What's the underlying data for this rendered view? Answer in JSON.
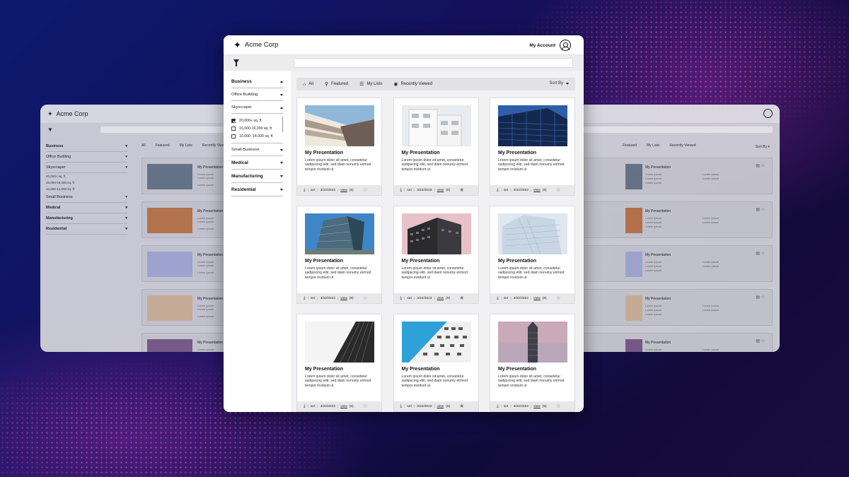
{
  "app": {
    "name": "Acme Corp",
    "account_label": "My Account",
    "search_placeholder": ""
  },
  "sidebar": {
    "sections": [
      {
        "label": "Business",
        "bold": true,
        "expanded": true
      },
      {
        "label": "Office Building",
        "bold": false,
        "expanded": false
      },
      {
        "label": "Skyscraper",
        "bold": false,
        "expanded": true
      },
      {
        "label": "Small Business",
        "bold": false,
        "expanded": false
      },
      {
        "label": "Medical",
        "bold": true,
        "expanded": false
      },
      {
        "label": "Manufacturing",
        "bold": true,
        "expanded": false
      },
      {
        "label": "Residential",
        "bold": true,
        "expanded": false
      }
    ],
    "skyscraper_options": [
      {
        "label": "20,000+ sq. ft",
        "checked": true
      },
      {
        "label": "15,000-19,000 sq. ft",
        "checked": false
      },
      {
        "label": "10,000- 14,000 sq. ft",
        "checked": false
      }
    ]
  },
  "tabs": [
    {
      "label": "All",
      "icon": "home-icon"
    },
    {
      "label": "Featured",
      "icon": "pin-icon"
    },
    {
      "label": "My Lists",
      "icon": "list-icon"
    },
    {
      "label": "Recently Viewed",
      "icon": "eye-icon"
    }
  ],
  "sort_label": "Sort By",
  "cards": [
    {
      "title": "My Presentation",
      "desc": "Lorem ipsum dolor sit amet, consetetur sadipscing elitr, sed diam nonumy eirmod tempor invidunt ut",
      "set": "set",
      "date": "3/22/2023",
      "view": "view",
      "count": "(8)",
      "starred": false,
      "img": "building-1"
    },
    {
      "title": "My Presentation",
      "desc": "Lorem ipsum dolor sit amet, consetetur sadipscing elitr, sed diam nonumy eirmod tempor invidunt ut",
      "set": "set",
      "date": "3/22/2023",
      "view": "view",
      "count": "(8)",
      "starred": true,
      "img": "building-2"
    },
    {
      "title": "My Presentation",
      "desc": "Lorem ipsum dolor sit amet, consetetur sadipscing elitr, sed diam nonumy eirmod tempor invidunt ut",
      "set": "set",
      "date": "3/22/2023",
      "view": "view",
      "count": "(8)",
      "starred": false,
      "img": "building-3"
    },
    {
      "title": "My Presentation",
      "desc": "Lorem ipsum dolor sit amet, consetetur sadipscing elitr, sed diam nonumy eirmod tempor invidunt ut",
      "set": "set",
      "date": "3/22/2023",
      "view": "view",
      "count": "(8)",
      "starred": false,
      "img": "building-4"
    },
    {
      "title": "My Presentation",
      "desc": "Lorem ipsum dolor sit amet, consetetur sadipscing elitr, sed diam nonumy eirmod tempor invidunt ut",
      "set": "set",
      "date": "3/22/2023",
      "view": "view",
      "count": "(8)",
      "starred": true,
      "img": "building-5"
    },
    {
      "title": "My Presentation",
      "desc": "Lorem ipsum dolor sit amet, consetetur sadipscing elitr, sed diam nonumy eirmod tempor invidunt ut",
      "set": "set",
      "date": "3/22/2023",
      "view": "view",
      "count": "(8)",
      "starred": false,
      "img": "building-6"
    },
    {
      "title": "My Presentation",
      "desc": "Lorem ipsum dolor sit amet, consetetur sadipscing elitr, sed diam nonumy eirmod tempor invidunt ut",
      "set": "set",
      "date": "3/22/2023",
      "view": "view",
      "count": "(8)",
      "starred": false,
      "img": "building-7"
    },
    {
      "title": "My Presentation",
      "desc": "Lorem ipsum dolor sit amet, consetetur sadipscing elitr, sed diam nonumy eirmod tempor invidunt ut",
      "set": "set",
      "date": "3/22/2023",
      "view": "view",
      "count": "(8)",
      "starred": true,
      "img": "building-8"
    },
    {
      "title": "My Presentation",
      "desc": "Lorem ipsum dolor sit amet, consetetur sadipscing elitr, sed diam nonumy eirmod tempor invidunt ut",
      "set": "set",
      "date": "3/22/2023",
      "view": "view",
      "count": "(8)",
      "starred": false,
      "img": "building-9"
    }
  ],
  "back_window": {
    "name": "Acme Corp",
    "sidebar": [
      "Business",
      "Office Building",
      "Skyscraper",
      "20,000+ sq. ft",
      "15,000-19,000 sq. ft",
      "10,000-14,000 sq. ft",
      "Small Business",
      "Medical",
      "Manufacturing",
      "Residential"
    ],
    "tabs": [
      "All",
      "Featured",
      "My Lists",
      "Recently Viewed"
    ],
    "tabs_right": [
      "Featured",
      "My Lists",
      "Recently Viewed"
    ],
    "sort_label": "Sort By",
    "row_title": "My Presentation",
    "row_meta": "Lorem ipsum"
  },
  "colors": {
    "accent": "#111111",
    "footer_bg": "#e8e8eb",
    "tab_bg": "#e2e2e6"
  }
}
